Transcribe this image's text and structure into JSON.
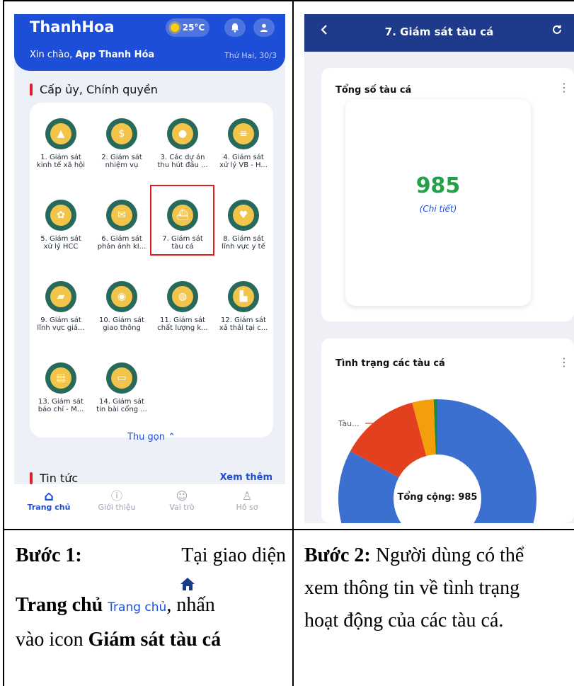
{
  "phone1": {
    "brand": "ThanhHoa",
    "temperature": "25°C",
    "greeting_prefix": "Xin chào,",
    "greeting_name": "App Thanh Hóa",
    "date": "Thứ Hai, 30/3",
    "section_title": "Cấp ủy, Chính quyền",
    "items": [
      {
        "l1": "1. Giám sát",
        "l2": "kinh tế xã hội",
        "icon": "chart-icon"
      },
      {
        "l1": "2. Giám sát",
        "l2": "nhiệm vụ",
        "icon": "coin-icon"
      },
      {
        "l1": "3. Các dự án",
        "l2": "thu hút đầu ...",
        "icon": "money-hand-icon"
      },
      {
        "l1": "4. Giám sát",
        "l2": "xử lý VB - H...",
        "icon": "documents-icon"
      },
      {
        "l1": "5. Giám sát",
        "l2": "xử lý HCC",
        "icon": "ribbon-icon"
      },
      {
        "l1": "6. Giám sát",
        "l2": "phản ánh kI...",
        "icon": "envelope-icon"
      },
      {
        "l1": "7. Giám sát",
        "l2": "tàu cá",
        "icon": "ship-icon"
      },
      {
        "l1": "8. Giám sát",
        "l2": "lĩnh vực y tế",
        "icon": "heartbeat-icon"
      },
      {
        "l1": "9. Giám sát",
        "l2": "lĩnh vực giá...",
        "icon": "graduation-cap-icon"
      },
      {
        "l1": "10. Giám sát",
        "l2": "giao thông",
        "icon": "camera-icon"
      },
      {
        "l1": "11. Giám sát",
        "l2": "chất lượng k...",
        "icon": "globe-icon"
      },
      {
        "l1": "12. Giám sát",
        "l2": "xả thải tại c...",
        "icon": "factory-icon"
      },
      {
        "l1": "13. Giám sát",
        "l2": "báo chí - M...",
        "icon": "newspaper-icon"
      },
      {
        "l1": "14. Giám sát",
        "l2": "tin bài cổng ...",
        "icon": "monitor-icon"
      }
    ],
    "collapse_label": "Thu gọn",
    "news_title": "Tin tức",
    "news_more": "Xem thêm",
    "tabs": [
      {
        "label": "Trang chủ",
        "icon": "home-icon"
      },
      {
        "label": "Giới thiệu",
        "icon": "info-icon"
      },
      {
        "label": "Vai trò",
        "icon": "roles-icon"
      },
      {
        "label": "Hồ sơ",
        "icon": "profile-icon"
      }
    ]
  },
  "phone2": {
    "title": "7. Giám sát tàu cá",
    "total_title": "Tổng số tàu cá",
    "total_value": "985",
    "total_detail": "(Chi tiết)",
    "status_title": "Tình trạng các tàu cá",
    "slice_label": "Tàu...",
    "center_label": "Tổng cộng: 985"
  },
  "captions": {
    "step1_bold": "Bước 1:",
    "step1_text1": "Tại giao diện",
    "step1_home_bold": "Trang chủ",
    "step1_home_small": "Trang chủ",
    "step1_text2": ", nhấn",
    "step1_text3": "vào icon",
    "step1_bold2": "Giám sát tàu cá",
    "step2_bold": "Bước 2:",
    "step2_l1": "Người dùng có thể",
    "step2_l2": "xem thông tin về tình trạng",
    "step2_l3": "hoạt động của các tàu cá."
  },
  "colors": {
    "primary": "#1d4ed8",
    "header_dark": "#1e3a8a",
    "highlight": "#e11d1d",
    "value_green": "#22a04a"
  },
  "chart_data": {
    "type": "pie",
    "title": "Tình trạng các tàu cá",
    "total": 985,
    "slices": [
      {
        "label": "Tàu...",
        "value": 0.13,
        "color": "#e2401f"
      },
      {
        "label": "",
        "value": 0.035,
        "color": "#f59e0b"
      },
      {
        "label": "",
        "value": 0.006,
        "color": "#1f8a3b"
      },
      {
        "label": "",
        "value": 0.829,
        "color": "#3b6fd0"
      }
    ]
  }
}
